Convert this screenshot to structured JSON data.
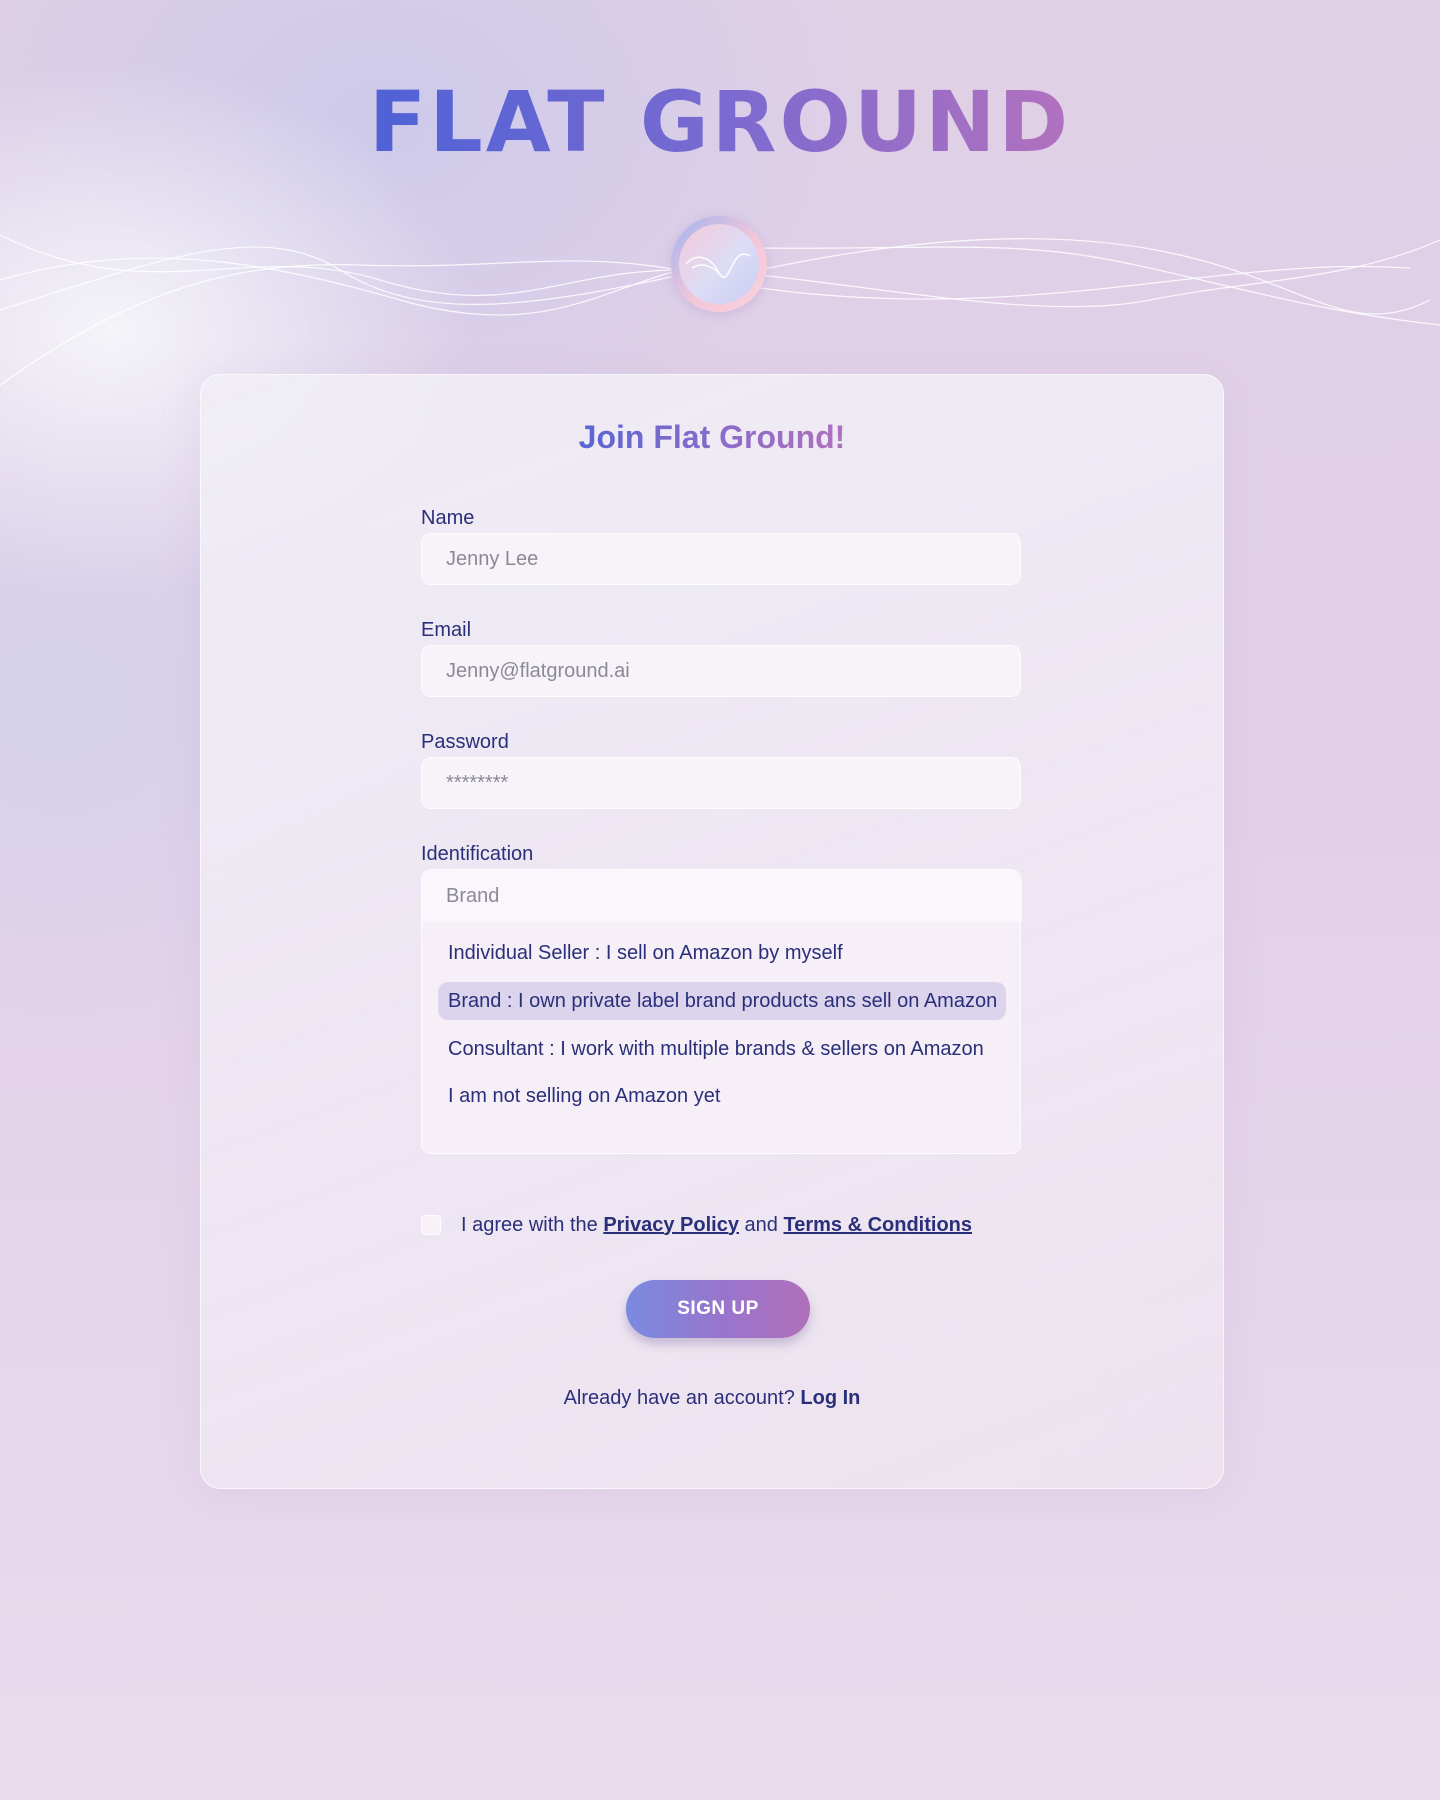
{
  "brand": {
    "title": "FLAT GROUND"
  },
  "form": {
    "title": "Join Flat Ground!",
    "name": {
      "label": "Name",
      "placeholder": "Jenny Lee"
    },
    "email": {
      "label": "Email",
      "placeholder": "Jenny@flatground.ai"
    },
    "password": {
      "label": "Password",
      "placeholder": "********"
    },
    "identification": {
      "label": "Identification",
      "selected": "Brand",
      "options": [
        "Individual Seller : I sell on Amazon by myself",
        "Brand : I own private label brand products ans sell on Amazon",
        "Consultant : I work with multiple brands & sellers on Amazon",
        "I am not selling on Amazon yet"
      ],
      "active_option": "Brand : I own private label brand products ans sell on Amazon"
    },
    "agree": {
      "prefix": "I agree with the",
      "privacy_link": "Privacy Policy",
      "and": "and",
      "terms_link": "Terms & Conditions",
      "checked": false
    },
    "signup_label": "SIGN UP",
    "login_prompt": "Already have an account?",
    "login_link": "Log In"
  },
  "colors": {
    "text": "#2a2f7a",
    "accent_start": "#4e62d6",
    "accent_end": "#b271be",
    "option_highlight": "#dcd4ec"
  },
  "icons": {
    "logo": "wave-logo-icon"
  }
}
